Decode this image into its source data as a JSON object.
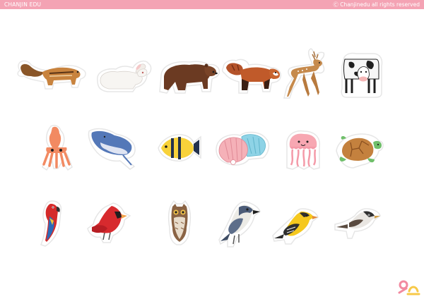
{
  "header": {
    "brand": "CHANJIN EDU",
    "copyright": "Ⓒ Chanjinedu all rights reserved"
  },
  "colors": {
    "header_bg": "#f4a3b4",
    "logo_pink": "#f28aa0",
    "logo_yellow": "#f7c948"
  },
  "stickers": {
    "row1": [
      "chipmunk-icon",
      "rabbit-icon",
      "brown-bear-icon",
      "red-panda-icon",
      "deer-icon",
      "cow-icon"
    ],
    "row2": [
      "squid-icon",
      "manta-ray-icon",
      "tropical-fish-icon",
      "seashell-icon",
      "jellyfish-icon",
      "sea-turtle-icon"
    ],
    "row3": [
      "parrot-icon",
      "cardinal-icon",
      "owl-icon",
      "kingfisher-bird-icon",
      "yellow-warbler-icon",
      "sparrow-icon"
    ]
  },
  "logo": "chanjin-logo-icon"
}
